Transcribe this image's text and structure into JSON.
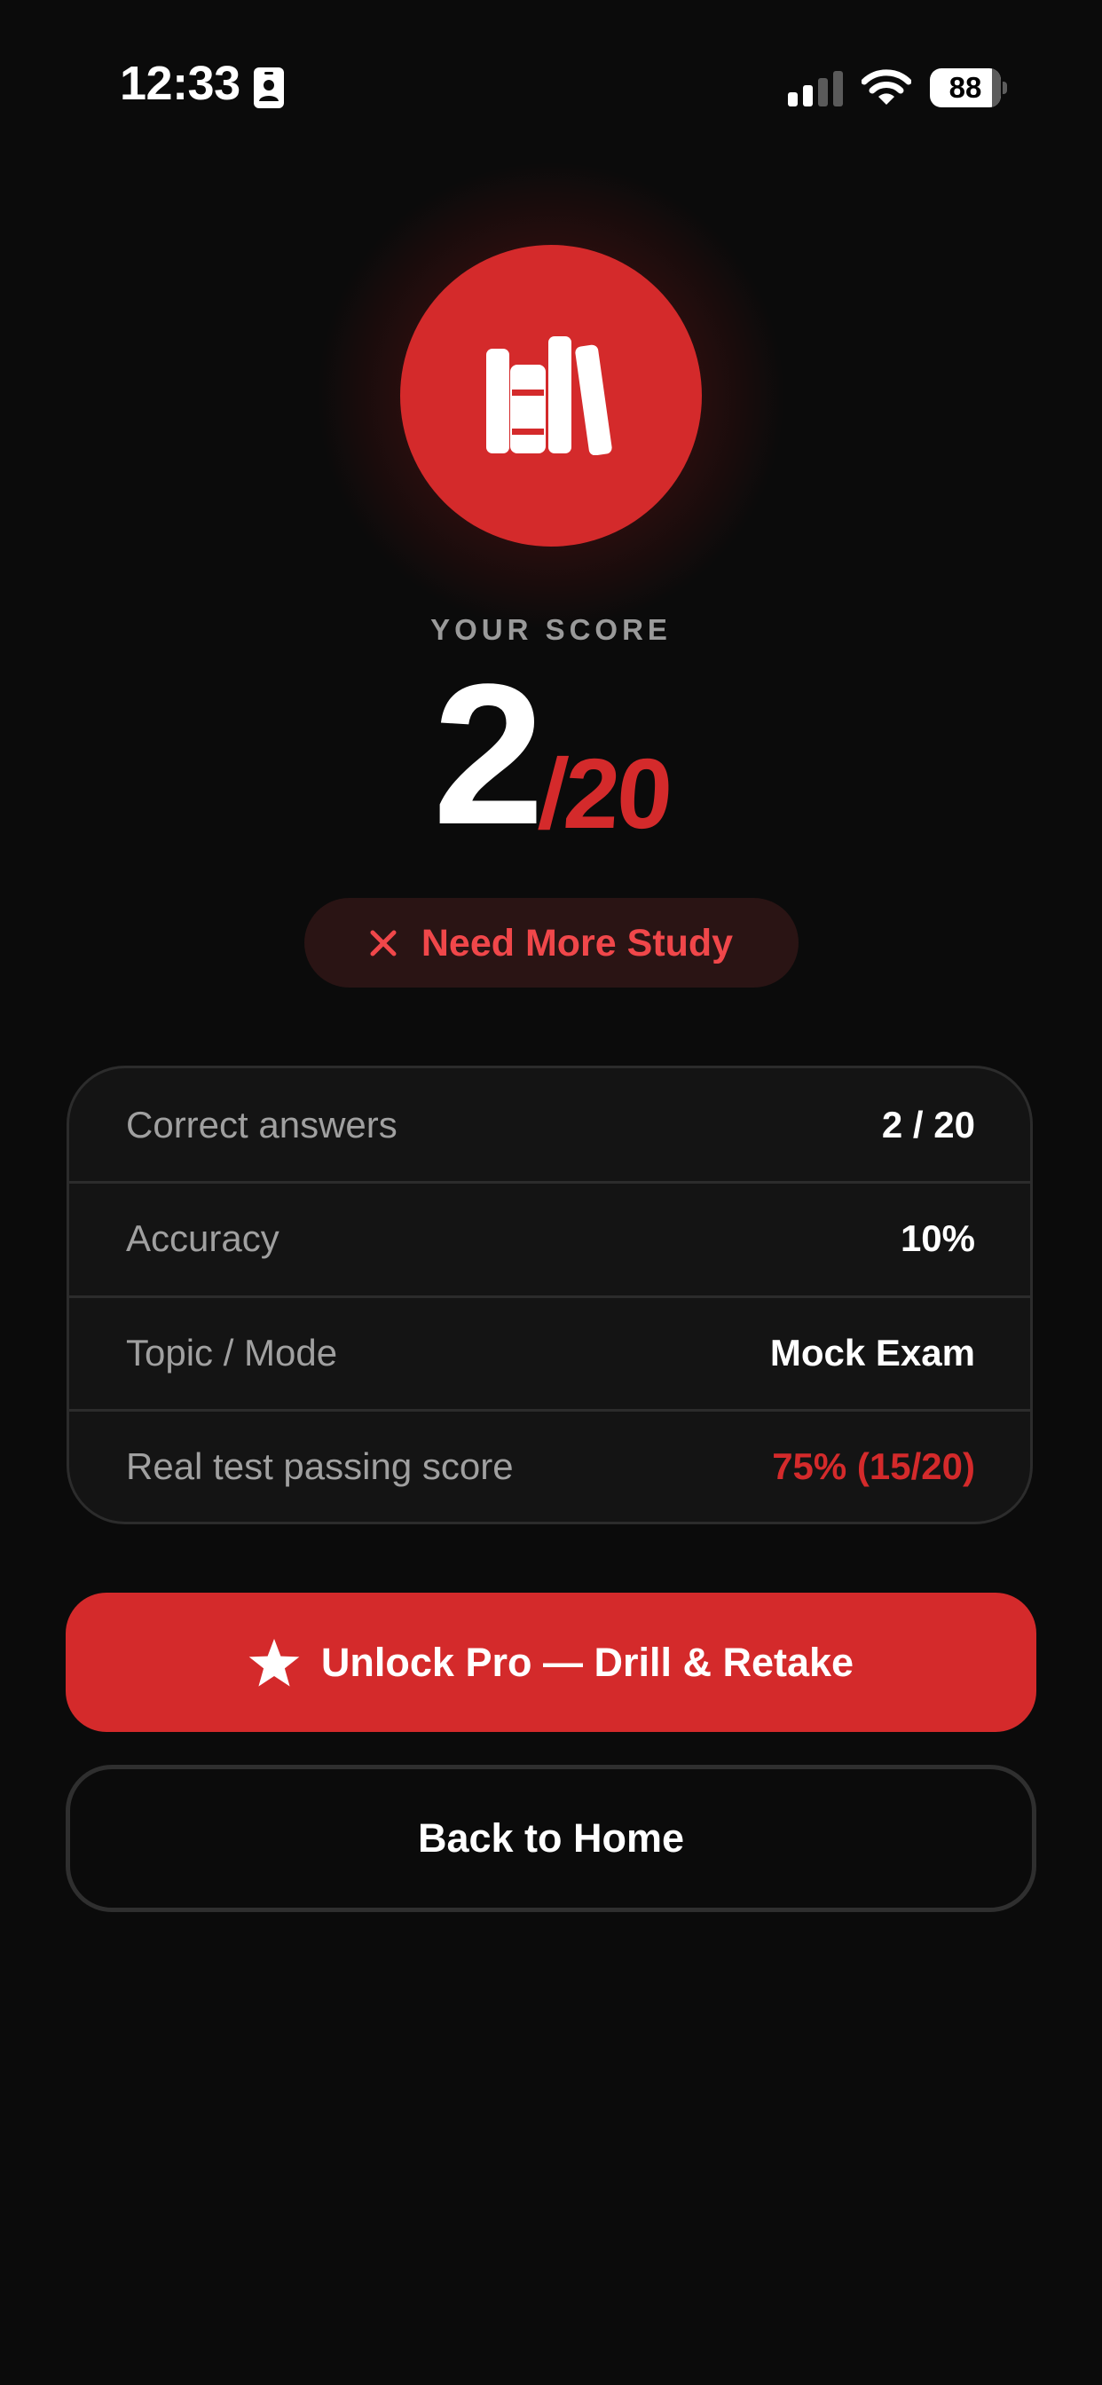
{
  "status_bar": {
    "time": "12:33",
    "battery_level": "88"
  },
  "results": {
    "score_label": "YOUR SCORE",
    "score_value": "2",
    "score_total": "/20",
    "verdict": "Need More Study"
  },
  "stats": [
    {
      "label": "Correct answers",
      "value": "2 / 20"
    },
    {
      "label": "Accuracy",
      "value": "10%"
    },
    {
      "label": "Topic / Mode",
      "value": "Mock Exam"
    },
    {
      "label": "Real test passing score",
      "value": "75% (15/20)"
    }
  ],
  "actions": {
    "unlock_label": "Unlock Pro — Drill & Retake",
    "home_label": "Back to Home"
  },
  "icons": {
    "badge": "books-icon",
    "verdict": "close-icon",
    "unlock": "star-icon"
  },
  "colors": {
    "background": "#0b0b0b",
    "accent": "#d42a2b",
    "verdict_text": "#f0474a",
    "muted_text": "#a0a0a0",
    "card": "#141414"
  }
}
